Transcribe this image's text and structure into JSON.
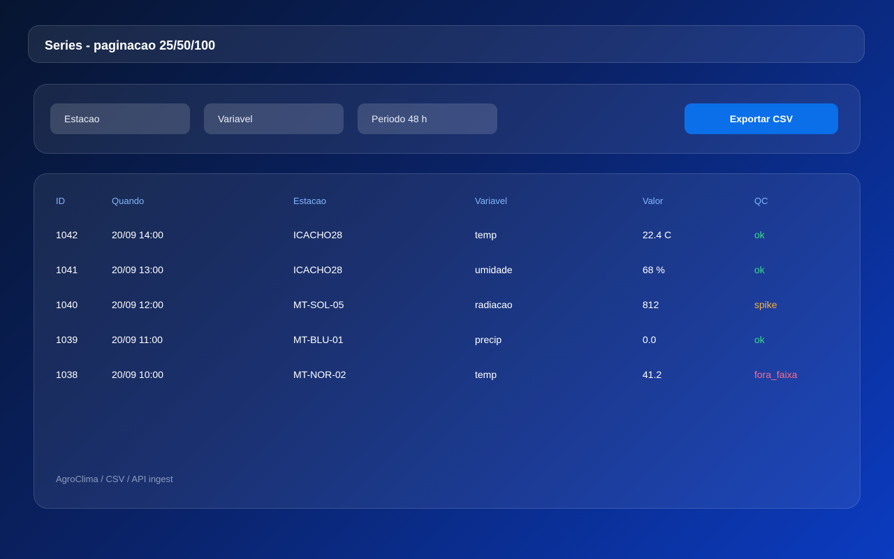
{
  "header": {
    "title": "Series - paginacao 25/50/100"
  },
  "filters": {
    "estacao": "Estacao",
    "variavel": "Variavel",
    "periodo": "Periodo 48 h",
    "export_label": "Exportar CSV"
  },
  "table": {
    "columns": {
      "id": "ID",
      "quando": "Quando",
      "estacao": "Estacao",
      "variavel": "Variavel",
      "valor": "Valor",
      "qc": "QC"
    },
    "rows": [
      {
        "id": "1042",
        "quando": "20/09 14:00",
        "estacao": "ICACHO28",
        "variavel": "temp",
        "valor": "22.4 C",
        "qc": "ok"
      },
      {
        "id": "1041",
        "quando": "20/09 13:00",
        "estacao": "ICACHO28",
        "variavel": "umidade",
        "valor": "68 %",
        "qc": "ok"
      },
      {
        "id": "1040",
        "quando": "20/09 12:00",
        "estacao": "MT-SOL-05",
        "variavel": "radiacao",
        "valor": "812",
        "qc": "spike"
      },
      {
        "id": "1039",
        "quando": "20/09 11:00",
        "estacao": "MT-BLU-01",
        "variavel": "precip",
        "valor": "0.0",
        "qc": "ok"
      },
      {
        "id": "1038",
        "quando": "20/09 10:00",
        "estacao": "MT-NOR-02",
        "variavel": "temp",
        "valor": "41.2",
        "qc": "fora_faixa"
      }
    ]
  },
  "footer": {
    "note": "AgroClima / CSV / API ingest"
  },
  "colors": {
    "accent": "#0a6fe8",
    "header_text": "#7fb7ff",
    "qc_ok": "#39d98a",
    "qc_spike": "#f5b13d",
    "qc_fora_faixa": "#ff6b8a"
  }
}
